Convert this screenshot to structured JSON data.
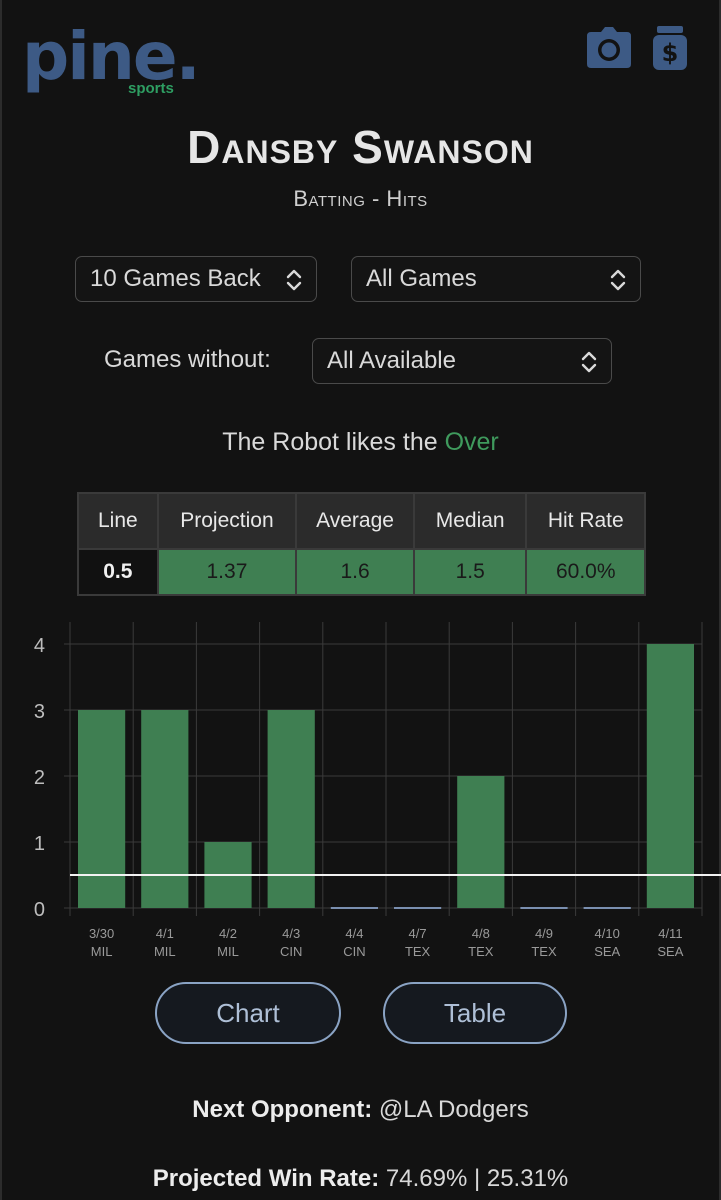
{
  "logo": {
    "main": "pine.",
    "sub": "sports"
  },
  "icons": {
    "camera": "camera-icon",
    "money": "money-bag-icon"
  },
  "colors": {
    "accent_green": "#3f7f52",
    "brand_blue": "#3d5a85",
    "over_green": "#3f9a5d",
    "pill_border": "#8aa3c4"
  },
  "player": {
    "name": "Dansby Swanson",
    "stat": "Batting - Hits"
  },
  "filters": {
    "games_back": "10 Games Back",
    "game_filter": "All Games",
    "without_label": "Games without:",
    "without_value": "All Available"
  },
  "robot": {
    "prefix": "The Robot likes the ",
    "pick": "Over"
  },
  "stats": {
    "headers": [
      "Line",
      "Projection",
      "Average",
      "Median",
      "Hit Rate"
    ],
    "values": [
      "0.5",
      "1.37",
      "1.6",
      "1.5",
      "60.0%"
    ]
  },
  "chart_data": {
    "type": "bar",
    "categories": [
      "3/30",
      "4/1",
      "4/2",
      "4/3",
      "4/4",
      "4/7",
      "4/8",
      "4/9",
      "4/10",
      "4/11"
    ],
    "opponents": [
      "MIL",
      "MIL",
      "MIL",
      "CIN",
      "CIN",
      "TEX",
      "TEX",
      "TEX",
      "SEA",
      "SEA"
    ],
    "values": [
      3,
      3,
      1,
      3,
      0,
      0,
      2,
      0,
      0,
      4
    ],
    "y_ticks": [
      0,
      1,
      2,
      3,
      4
    ],
    "ylim": [
      0,
      4
    ],
    "line": 0.5,
    "grid": true
  },
  "view_toggle": {
    "chart": "Chart",
    "table": "Table"
  },
  "next_opponent": {
    "label": "Next Opponent:",
    "value": " @LA Dodgers"
  },
  "win_rate": {
    "label": "Projected Win Rate:",
    "value": " 74.69% | 25.31%"
  }
}
